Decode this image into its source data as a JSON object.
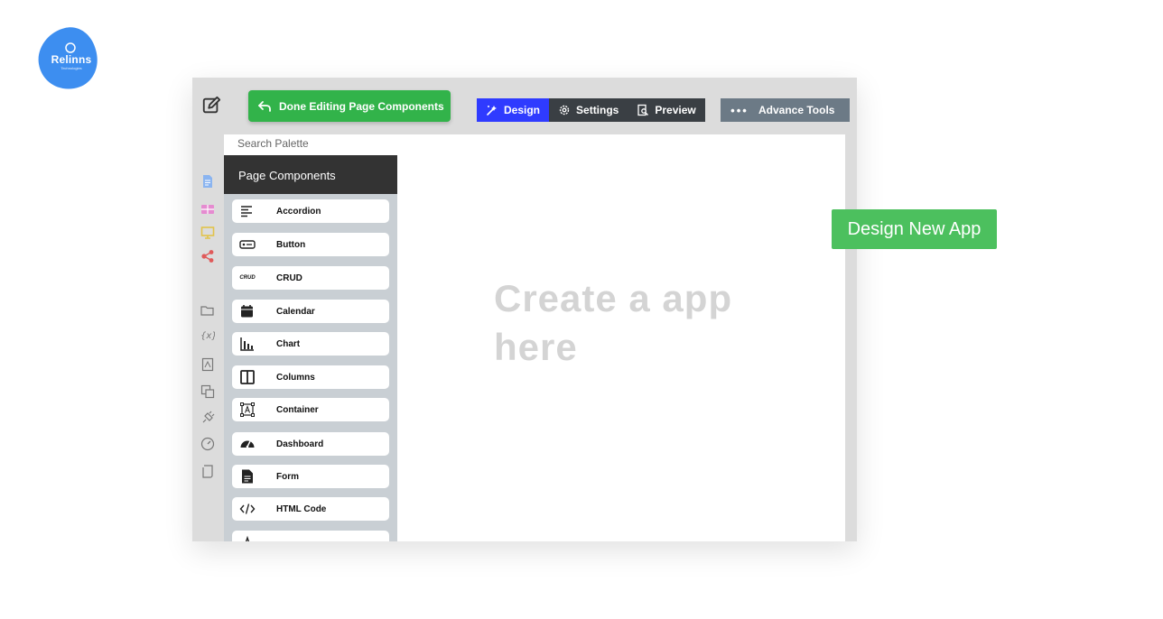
{
  "brand": {
    "logo_text": "Relinns",
    "logo_subtext": "Technologies",
    "color": "#3d8ef0"
  },
  "toolbar": {
    "done_label": "Done Editing Page Components",
    "done_color": "#32b34a",
    "tabs": [
      {
        "label": "Design",
        "icon": "design-tools-icon",
        "active": true
      },
      {
        "label": "Settings",
        "icon": "gear-icon",
        "active": false
      },
      {
        "label": "Preview",
        "icon": "preview-icon",
        "active": false
      }
    ],
    "advance_label": "Advance Tools",
    "advance_icon": "more-dots-icon",
    "active_tab_color": "#2f3bff"
  },
  "rail": {
    "icons": [
      "page-icon",
      "table-icon",
      "monitor-icon",
      "share-icon",
      "folder-icon",
      "variable-icon",
      "pdf-icon",
      "translate-icon",
      "plug-icon",
      "gauge-icon",
      "script-icon"
    ]
  },
  "palette": {
    "search_placeholder": "Search Palette",
    "header": "Page Components",
    "items": [
      {
        "label": "Accordion",
        "icon": "accordion-icon"
      },
      {
        "label": "Button",
        "icon": "button-icon"
      },
      {
        "label": "CRUD",
        "icon": "crud-icon",
        "icon_text": "CRUD"
      },
      {
        "label": "Calendar",
        "icon": "calendar-icon"
      },
      {
        "label": "Chart",
        "icon": "bar-chart-icon"
      },
      {
        "label": "Columns",
        "icon": "columns-icon"
      },
      {
        "label": "Container",
        "icon": "container-icon"
      },
      {
        "label": "Dashboard",
        "icon": "speedometer-icon"
      },
      {
        "label": "Form",
        "icon": "form-icon"
      },
      {
        "label": "HTML Code",
        "icon": "code-icon"
      }
    ]
  },
  "canvas": {
    "hint_line1": "Create a app",
    "hint_line2": "here"
  },
  "badge": {
    "label": "Design New App",
    "color": "#4cc05e"
  }
}
